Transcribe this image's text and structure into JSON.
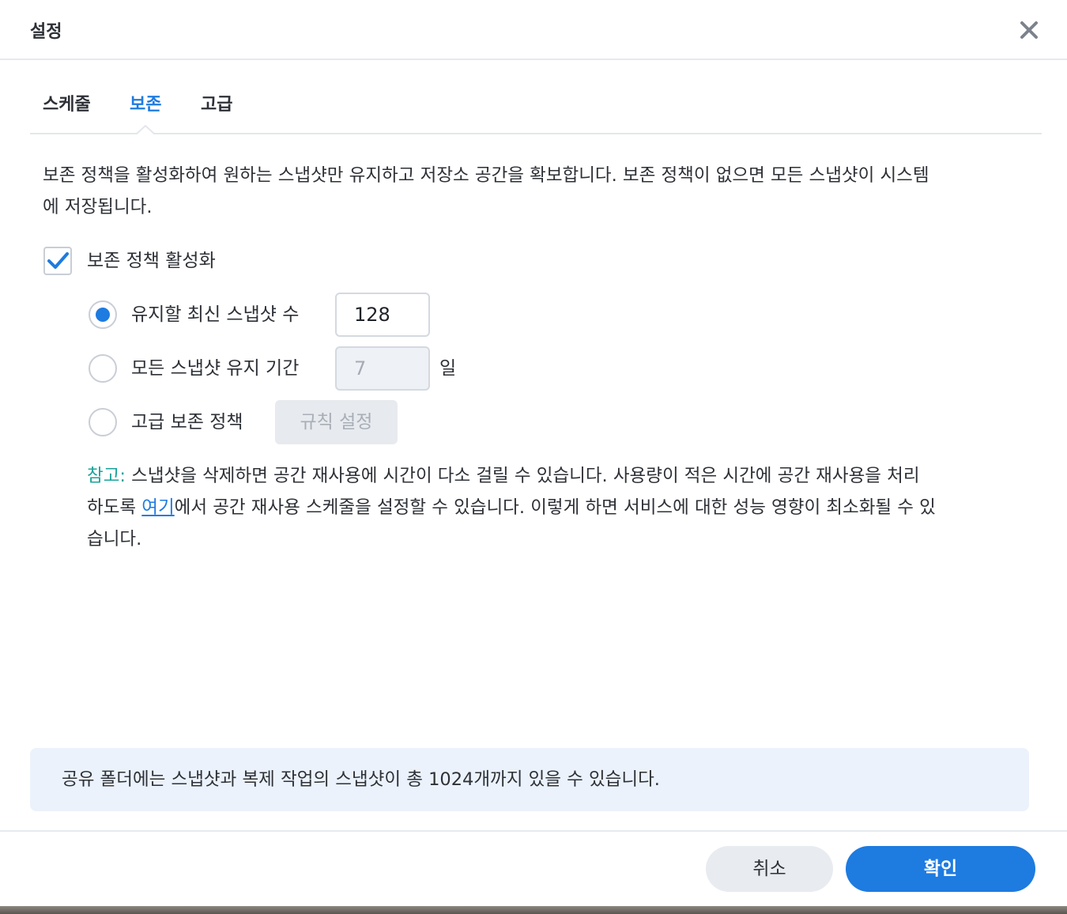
{
  "dialog": {
    "title": "설정"
  },
  "tabs": [
    {
      "label": "스케줄",
      "active": false
    },
    {
      "label": "보존",
      "active": true
    },
    {
      "label": "고급",
      "active": false
    }
  ],
  "retention": {
    "description_line1": "보존 정책을 활성화하여 원하는 스냅샷만 유지하고 저장소 공간을 확보합니다. 보존 정책이 없으면 모든 스냅샷이 시스템",
    "description_line2": "에 저장됩니다.",
    "enable_label": "보존 정책 활성화",
    "enable_checked": true,
    "options": [
      {
        "label": "유지할 최신 스냅샷 수",
        "value": "128",
        "selected": true
      },
      {
        "label": "모든 스냅샷 유지 기간",
        "value": "7",
        "unit": "일",
        "selected": false
      },
      {
        "label": "고급 보존 정책",
        "button_label": "규칙 설정",
        "selected": false
      }
    ],
    "note": {
      "label": "참고:",
      "text_line1": " 스냅샷을 삭제하면 공간 재사용에 시간이 다소 걸릴 수 있습니다. 사용량이 적은 시간에 공간 재사용을 처리",
      "text_line2_prefix": "하도록 ",
      "link": "여기",
      "text_line2_suffix": "에서 공간 재사용 스케줄을 설정할 수 있습니다. 이렇게 하면 서비스에 대한 성능 영향이 최소화될 수 있",
      "text_line3": "습니다."
    }
  },
  "info": "공유 폴더에는 스냅샷과 복제 작업의 스냅샷이 총 1024개까지 있을 수 있습니다.",
  "footer": {
    "cancel": "취소",
    "ok": "확인"
  },
  "colors": {
    "accent": "#1e7be0",
    "note_label": "#1aa39a",
    "info_bg": "#ebf2fb"
  },
  "icons": {
    "close": "close-icon",
    "check": "checkmark-icon"
  }
}
